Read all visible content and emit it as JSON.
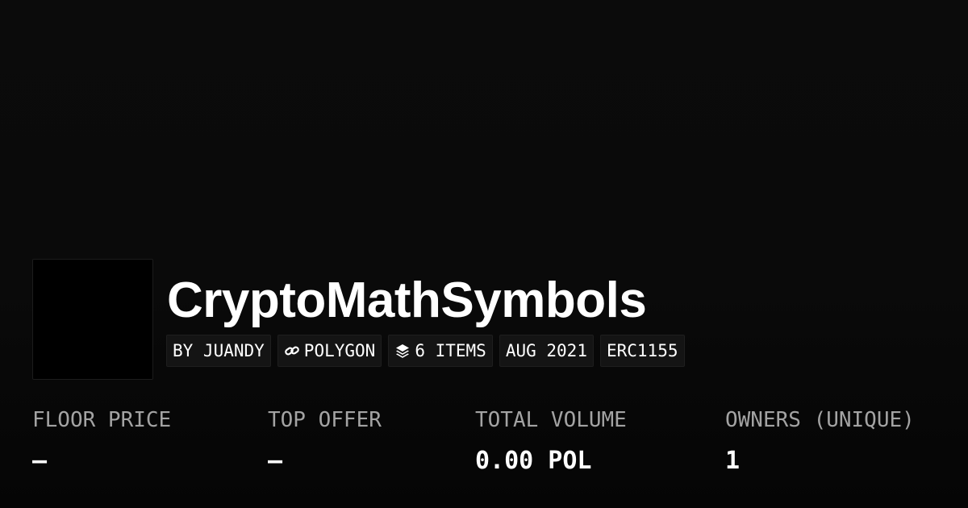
{
  "collection": {
    "title": "CryptoMathSymbols"
  },
  "tags": {
    "creator": "BY JUANDY",
    "chain": "POLYGON",
    "items": "6 ITEMS",
    "date": "AUG 2021",
    "standard": "ERC1155",
    "chain_icon": "link-icon",
    "items_icon": "layers-icon"
  },
  "stats": {
    "floor_price": {
      "label": "FLOOR PRICE",
      "value": "–"
    },
    "top_offer": {
      "label": "TOP OFFER",
      "value": "–"
    },
    "total_volume": {
      "label": "TOTAL VOLUME",
      "value": "0.00 POL"
    },
    "owners": {
      "label": "OWNERS (UNIQUE)",
      "value": "1"
    }
  },
  "colors": {
    "background": "#0a0a0a",
    "tag_background": "#141414",
    "label": "#a3a3a3",
    "text": "#ffffff"
  }
}
